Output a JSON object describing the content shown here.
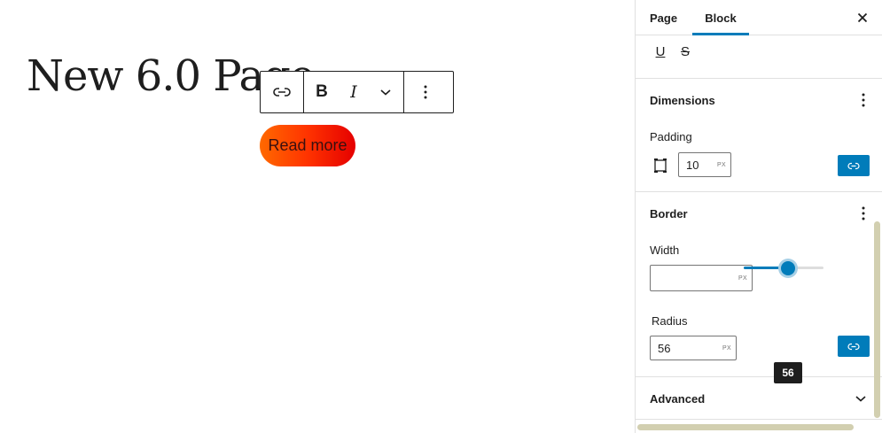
{
  "canvas": {
    "page_title": "New 6.0 Page",
    "button_text": "Read more",
    "toolbar": {
      "link_icon": "link-icon",
      "bold_label": "B",
      "italic_label": "I",
      "more_icon": "chevron-down-icon",
      "options_icon": "vertical-ellipsis-icon"
    }
  },
  "sidebar": {
    "tabs": [
      {
        "label": "Page"
      },
      {
        "label": "Block"
      }
    ],
    "active_tab": "Block",
    "close_icon": "close-icon",
    "format": {
      "underline_label": "U",
      "strikethrough_label": "S"
    },
    "dimensions": {
      "title": "Dimensions",
      "padding_label": "Padding",
      "padding_value": "10",
      "padding_unit": "PX"
    },
    "border": {
      "title": "Border",
      "width_label": "Width",
      "width_value": "",
      "width_unit": "PX",
      "radius_label": "Radius",
      "radius_value": "56",
      "radius_unit": "PX",
      "radius_slider_fraction": 0.55,
      "radius_tooltip": "56"
    },
    "advanced": {
      "title": "Advanced"
    }
  },
  "colors": {
    "accent": "#007cba",
    "button_gradient_start": "#ff6900",
    "button_gradient_end": "#e50000",
    "scrollbar": "#d2cfb0"
  }
}
